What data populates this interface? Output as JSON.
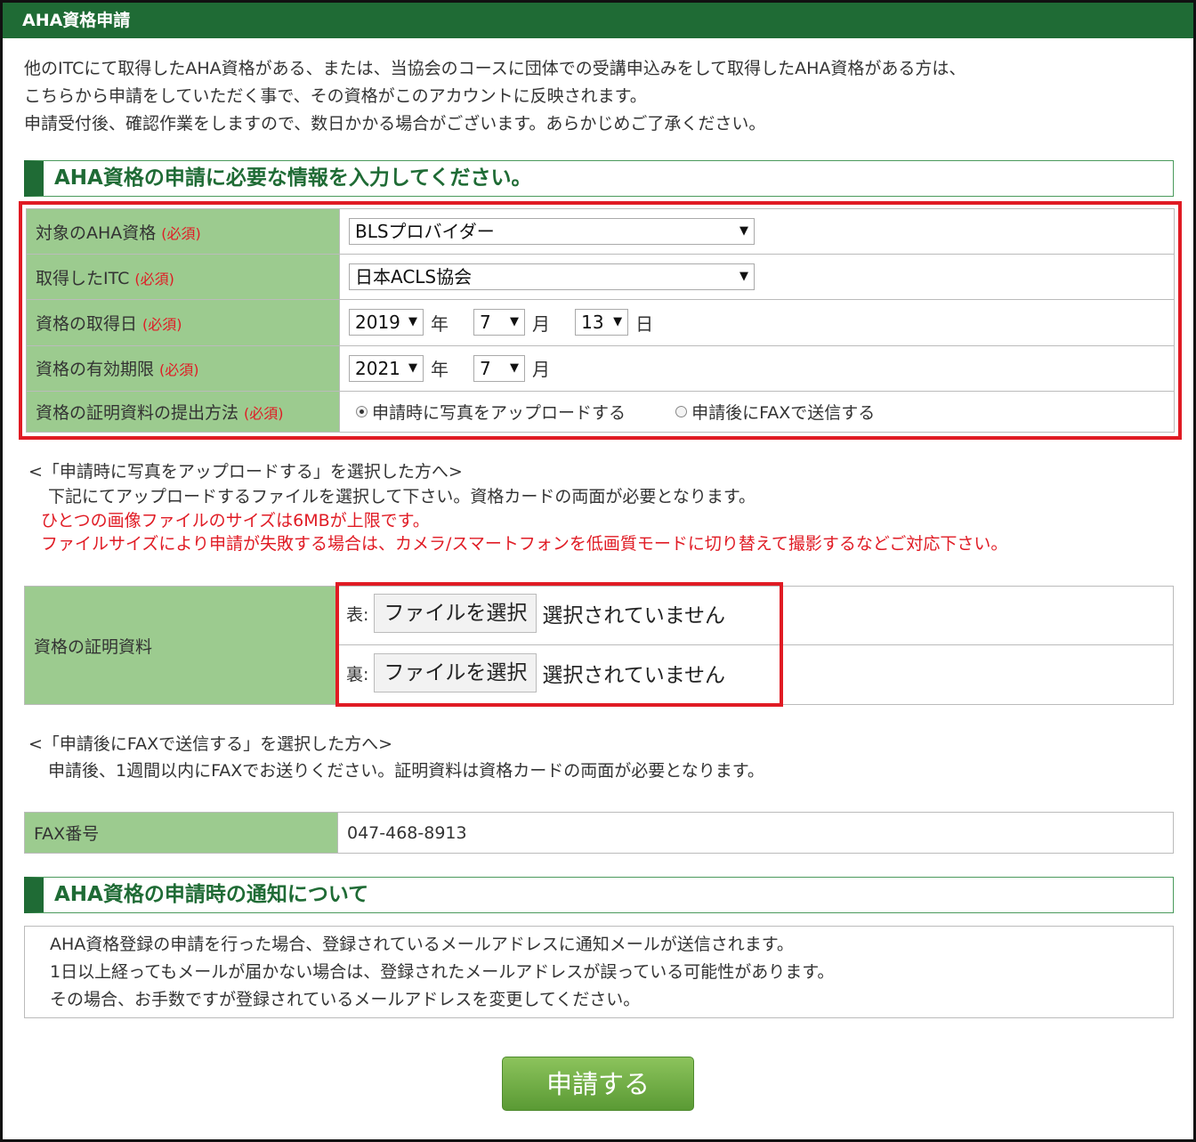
{
  "header": {
    "title": "AHA資格申請"
  },
  "intro": [
    "他のITCにて取得したAHA資格がある、または、当協会のコースに団体での受講申込みをして取得したAHA資格がある方は、",
    "こちらから申請をしていただく事で、その資格がこのアカウントに反映されます。",
    "申請受付後、確認作業をしますので、数日かかる場合がございます。あらかじめご了承ください。"
  ],
  "section1": {
    "title": "AHA資格の申請に必要な情報を入力してください。"
  },
  "required_label": "(必須)",
  "form": {
    "qualification": {
      "label": "対象のAHA資格",
      "value": "BLSプロバイダー"
    },
    "itc": {
      "label": "取得したITC",
      "value": "日本ACLS協会"
    },
    "acquired_date": {
      "label": "資格の取得日",
      "year": "2019",
      "month": "7",
      "day": "13"
    },
    "expiry": {
      "label": "資格の有効期限",
      "year": "2021",
      "month": "7"
    },
    "submit_method": {
      "label": "資格の証明資料の提出方法",
      "option1": "申請時に写真をアップロードする",
      "option2": "申請後にFAXで送信する",
      "selected": "option1"
    },
    "units": {
      "year": "年",
      "month": "月",
      "day": "日"
    }
  },
  "upload_note": {
    "heading": "<「申請時に写真をアップロードする」を選択した方へ>",
    "text": "下記にてアップロードするファイルを選択して下さい。資格カードの両面が必要となります。",
    "warn1": "ひとつの画像ファイルのサイズは6MBが上限です。",
    "warn2": "ファイルサイズにより申請が失敗する場合は、カメラ/スマートフォンを低画質モードに切り替えて撮影するなどご対応下さい。"
  },
  "upload": {
    "label": "資格の証明資料",
    "front_label": "表:",
    "back_label": "裏:",
    "button": "ファイルを選択",
    "status": "選択されていません"
  },
  "fax_note": {
    "heading": "<「申請後にFAXで送信する」を選択した方へ>",
    "text": "申請後、1週間以内にFAXでお送りください。証明資料は資格カードの両面が必要となります。"
  },
  "fax": {
    "label": "FAX番号",
    "number": "047-468-8913"
  },
  "section2": {
    "title": "AHA資格の申請時の通知について"
  },
  "notice": [
    "AHA資格登録の申請を行った場合、登録されているメールアドレスに通知メールが送信されます。",
    "1日以上経ってもメールが届かない場合は、登録されたメールアドレスが誤っている可能性があります。",
    "その場合、お手数ですが登録されているメールアドレスを変更してください。"
  ],
  "submit": {
    "label": "申請する"
  },
  "colors": {
    "header_green": "#1f6b35",
    "label_green": "#9ccb8f",
    "required_red": "#e01b24",
    "button_green": "#6aa840"
  }
}
